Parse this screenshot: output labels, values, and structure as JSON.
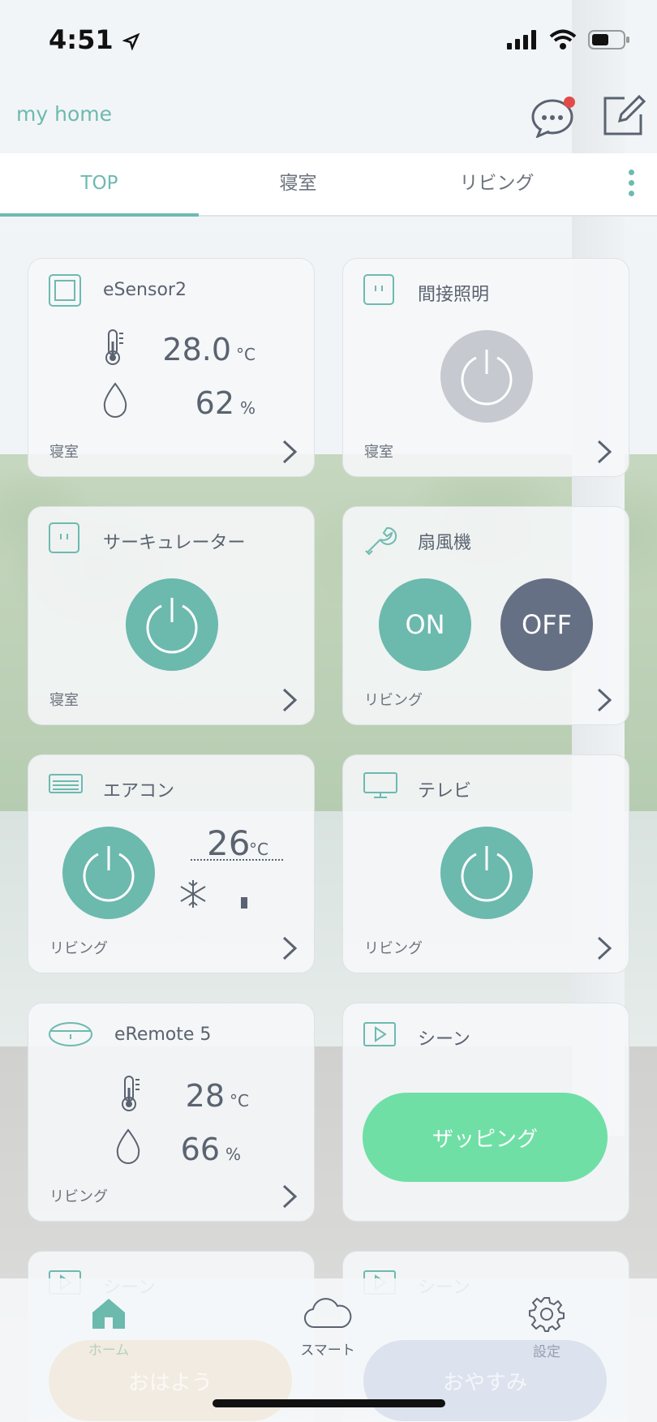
{
  "status_bar": {
    "time": "4:51"
  },
  "header": {
    "title": "my home"
  },
  "tabs": [
    {
      "label": "TOP",
      "active": true
    },
    {
      "label": "寝室",
      "active": false
    },
    {
      "label": "リビング",
      "active": false
    }
  ],
  "cards": {
    "esensor": {
      "title": "eSensor2",
      "temp": "28.0",
      "temp_unit": "°C",
      "humidity": "62",
      "humidity_unit": "%",
      "room": "寝室"
    },
    "indirect_light": {
      "title": "間接照明",
      "room": "寝室",
      "state": "off"
    },
    "circulator": {
      "title": "サーキュレーター",
      "room": "寝室",
      "state": "on"
    },
    "fan": {
      "title": "扇風機",
      "on_label": "ON",
      "off_label": "OFF",
      "room": "リビング"
    },
    "aircon": {
      "title": "エアコン",
      "temp": "26",
      "temp_unit": "°C",
      "mode": "cool",
      "room": "リビング"
    },
    "tv": {
      "title": "テレビ",
      "room": "リビング",
      "state": "on"
    },
    "eremote": {
      "title": "eRemote 5",
      "temp": "28",
      "temp_unit": "°C",
      "humidity": "66",
      "humidity_unit": "%",
      "room": "リビング"
    },
    "scene": {
      "title": "シーン",
      "button_label": "ザッピング"
    }
  },
  "peek_scenes": [
    {
      "title": "シーン",
      "button_label": "おはよう"
    },
    {
      "title": "シーン",
      "button_label": "おやすみ"
    }
  ],
  "bottom_nav": [
    {
      "label": "ホーム",
      "icon": "home-icon",
      "active": true
    },
    {
      "label": "スマート",
      "icon": "cloud-icon",
      "active": false
    },
    {
      "label": "設定",
      "icon": "gear-icon",
      "active": false
    }
  ],
  "colors": {
    "accent": "#6dbab0",
    "power_on": "#6cb9ae",
    "power_off": "#c6c9cf",
    "off_button": "#667084",
    "scene_green": "#6fdfa6",
    "badge_red": "#e24a4a"
  }
}
